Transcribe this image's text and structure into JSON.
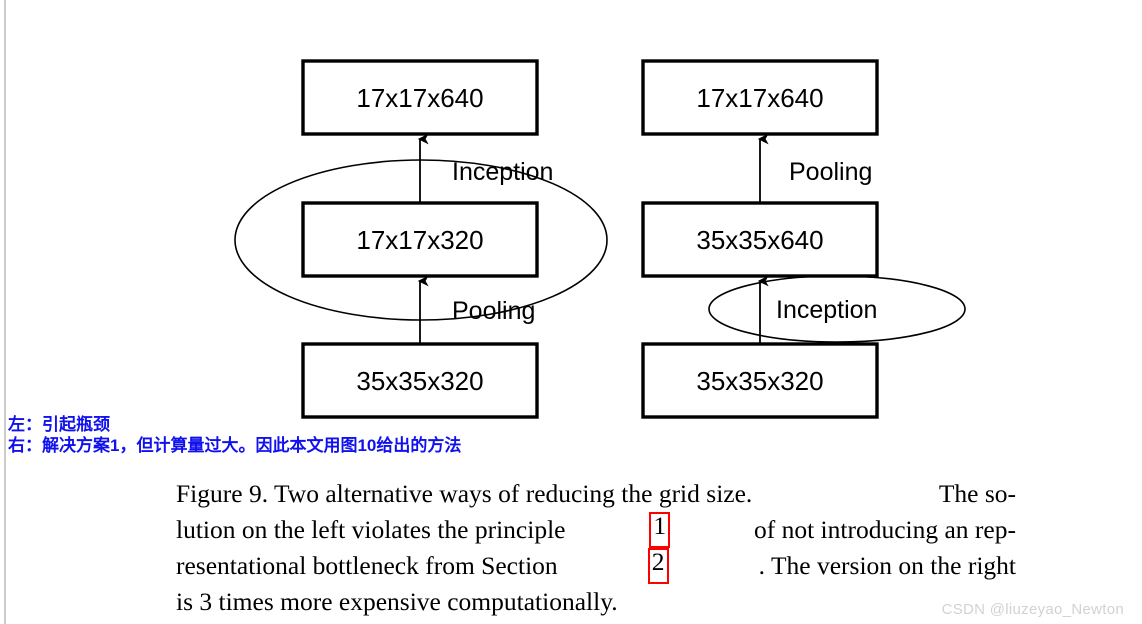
{
  "figure": {
    "left_diagram": {
      "name": "left-alternative",
      "boxes": [
        {
          "id": "l-top",
          "label": "17x17x640"
        },
        {
          "id": "l-middle",
          "label": "17x17x320"
        },
        {
          "id": "l-bottom",
          "label": "35x35x320"
        }
      ],
      "edges": [
        {
          "id": "l-edge-top",
          "label": "Inception"
        },
        {
          "id": "l-edge-bottom",
          "label": "Pooling"
        }
      ],
      "highlight_ellipse": {
        "id": "l-ellipse",
        "encloses": "17x17x320"
      }
    },
    "right_diagram": {
      "name": "right-alternative",
      "boxes": [
        {
          "id": "r-top",
          "label": "17x17x640"
        },
        {
          "id": "r-middle",
          "label": "35x35x640"
        },
        {
          "id": "r-bottom",
          "label": "35x35x320"
        }
      ],
      "edges": [
        {
          "id": "r-edge-top",
          "label": "Pooling"
        },
        {
          "id": "r-edge-bottom",
          "label": "Inception"
        }
      ],
      "highlight_ellipse": {
        "id": "r-ellipse",
        "encloses": "Inception"
      }
    },
    "stroke_color": "#000000",
    "box_fill": "#ffffff"
  },
  "annotation": {
    "color": "#1111ee",
    "lines": [
      "左：引起瓶颈",
      "右：解决方案1，但计算量过大。因此本文用图10给出的方法"
    ]
  },
  "caption": {
    "line1_a": "Figure 9. Two alternative ways of reducing the grid size.",
    "line1_b": "The so-",
    "line2_a": "lution on the left violates the principle",
    "line2_ref": "1",
    "line2_b": "of not introducing an rep-",
    "line3_a": "resentational bottleneck from Section",
    "line3_ref": "2",
    "line3_b": ". The version on the right",
    "line4": "is 3 times more expensive computationally.",
    "ref_box_color": "#ff0000"
  },
  "watermark": {
    "text": "CSDN @liuzeyao_Newton",
    "color": "#d2d2d2"
  }
}
